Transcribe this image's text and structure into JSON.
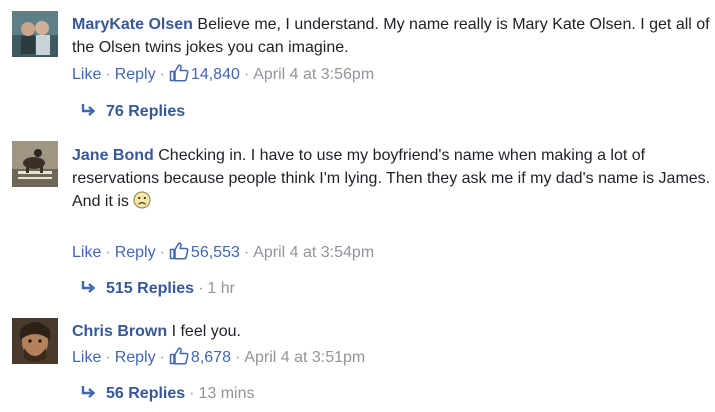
{
  "comments": [
    {
      "author": "MaryKate Olsen",
      "text": "Believe me, I understand. My name really is Mary Kate Olsen. I get all of the Olsen twins jokes you can imagine.",
      "like_label": "Like",
      "reply_label": "Reply",
      "like_count": "14,840",
      "timestamp": "April 4 at 3:56pm",
      "replies_label": "76 Replies",
      "replies_time": ""
    },
    {
      "author": "Jane Bond",
      "text": "Checking in. I have to use my boyfriend's name when making a lot of reservations because people think I'm lying. Then they ask me if my dad's name is James.",
      "text2": "And it is",
      "emoji": "frown-emoji",
      "like_label": "Like",
      "reply_label": "Reply",
      "like_count": "56,553",
      "timestamp": "April 4 at 3:54pm",
      "replies_label": "515 Replies",
      "replies_time": "1 hr"
    },
    {
      "author": "Chris Brown",
      "text": "I feel you.",
      "like_label": "Like",
      "reply_label": "Reply",
      "like_count": "8,678",
      "timestamp": "April 4 at 3:51pm",
      "replies_label": "56 Replies",
      "replies_time": "13 mins"
    }
  ],
  "colors": {
    "name": "#365899",
    "link": "#4267b2",
    "meta": "#90949c",
    "text": "#1d2129"
  },
  "icons": {
    "like": "thumbs-up-icon",
    "reply_arrow": "reply-arrow-icon"
  }
}
